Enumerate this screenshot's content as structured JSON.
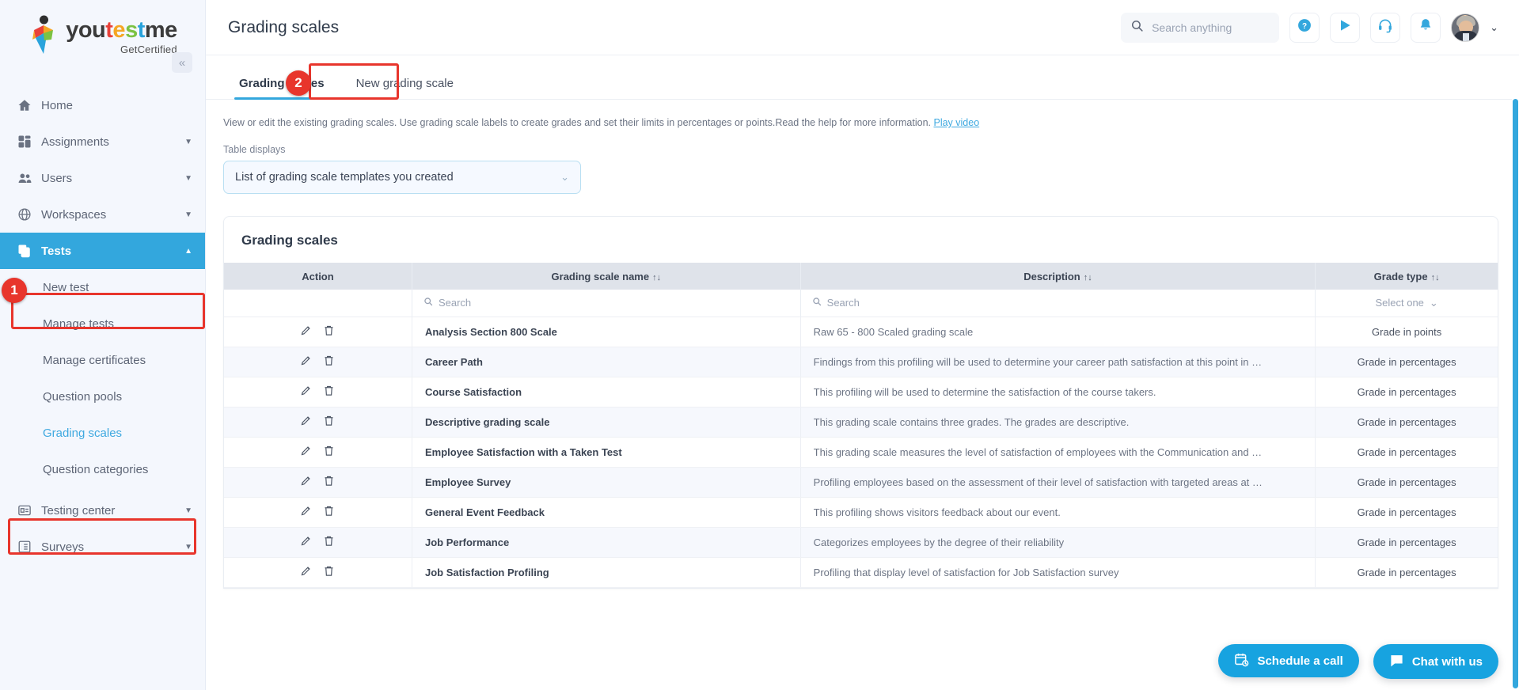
{
  "brand": {
    "name_parts": [
      "you",
      "t",
      "e",
      "s",
      "t",
      "me"
    ],
    "subtitle": "GetCertified",
    "accent": "#33a7dd"
  },
  "sidebar": {
    "collapse_icon": "double-chevron-left",
    "items": [
      {
        "label": "Home",
        "icon": "home-icon",
        "has_caret": false,
        "active": false
      },
      {
        "label": "Assignments",
        "icon": "assignments-icon",
        "has_caret": true,
        "active": false
      },
      {
        "label": "Users",
        "icon": "users-icon",
        "has_caret": true,
        "active": false
      },
      {
        "label": "Workspaces",
        "icon": "globe-icon",
        "has_caret": true,
        "active": false
      },
      {
        "label": "Tests",
        "icon": "tests-icon",
        "has_caret": true,
        "active": true
      }
    ],
    "sub_items": [
      {
        "label": "New test",
        "current": false
      },
      {
        "label": "Manage tests",
        "current": false
      },
      {
        "label": "Manage certificates",
        "current": false
      },
      {
        "label": "Question pools",
        "current": false
      },
      {
        "label": "Grading scales",
        "current": true
      },
      {
        "label": "Question categories",
        "current": false
      }
    ],
    "bottom_items": [
      {
        "label": "Testing center",
        "icon": "testing-center-icon",
        "has_caret": true
      },
      {
        "label": "Surveys",
        "icon": "surveys-icon",
        "has_caret": true
      }
    ]
  },
  "annotations": [
    {
      "number": "1",
      "target": "sidebar-tests-item"
    },
    {
      "number": "2",
      "target": "new-grading-scale-tab"
    }
  ],
  "header": {
    "title": "Grading scales",
    "search_placeholder": "Search anything",
    "search_value": "",
    "icons": [
      {
        "name": "help-icon",
        "glyph": "?"
      },
      {
        "name": "play-icon",
        "glyph": "▶"
      },
      {
        "name": "support-headset-icon",
        "glyph": "headset"
      },
      {
        "name": "notifications-bell-icon",
        "glyph": "bell"
      }
    ],
    "profile_caret": "chevron-down"
  },
  "tabs": [
    {
      "label": "Grading scales",
      "active": true
    },
    {
      "label": "New grading scale",
      "active": false
    }
  ],
  "hint": {
    "text": "View or edit the existing grading scales. Use grading scale labels to create grades and set their limits in percentages or points.Read the help for more information. ",
    "link_label": "Play video"
  },
  "table_displays": {
    "label": "Table displays",
    "value": "List of grading scale templates you created",
    "caret": "chevron-down"
  },
  "card": {
    "title": "Grading scales",
    "columns": [
      {
        "label": "Action",
        "sortable": false
      },
      {
        "label": "Grading scale name",
        "sortable": true,
        "sort_glyph": "↑↓"
      },
      {
        "label": "Description",
        "sortable": true,
        "sort_glyph": "↑↓"
      },
      {
        "label": "Grade type",
        "sortable": true,
        "sort_glyph": "↑↓"
      }
    ],
    "filters": {
      "name_search_placeholder": "Search",
      "description_search_placeholder": "Search",
      "grade_type_select": "Select one"
    },
    "rows": [
      {
        "name": "Analysis Section 800 Scale",
        "description": "Raw 65 - 800 Scaled grading scale",
        "grade_type": "Grade in points"
      },
      {
        "name": "Career Path",
        "description": "Findings from this profiling will be used to determine your career path satisfaction at this point in …",
        "grade_type": "Grade in percentages"
      },
      {
        "name": "Course Satisfaction",
        "description": "This profiling will be used to determine the satisfaction of the course takers.",
        "grade_type": "Grade in percentages"
      },
      {
        "name": "Descriptive grading scale",
        "description": "This grading scale contains three grades. The grades are descriptive.",
        "grade_type": "Grade in percentages"
      },
      {
        "name": "Employee Satisfaction with a Taken Test",
        "description": "This grading scale measures the level of satisfaction of employees with the Communication and …",
        "grade_type": "Grade in percentages"
      },
      {
        "name": "Employee Survey",
        "description": "Profiling employees based on the assessment of their level of satisfaction with targeted areas at …",
        "grade_type": "Grade in percentages"
      },
      {
        "name": "General Event Feedback",
        "description": "This profiling shows visitors feedback about our event.",
        "grade_type": "Grade in percentages"
      },
      {
        "name": "Job Performance",
        "description": "Categorizes employees by the degree of their reliability",
        "grade_type": "Grade in percentages"
      },
      {
        "name": "Job Satisfaction Profiling",
        "description": "Profiling that display level of satisfaction for Job Satisfaction survey",
        "grade_type": "Grade in percentages"
      }
    ],
    "row_actions": [
      {
        "name": "edit-icon",
        "title": "Edit"
      },
      {
        "name": "delete-icon",
        "title": "Delete"
      }
    ]
  },
  "floating": {
    "schedule_label": "Schedule a call",
    "chat_label": "Chat with us"
  }
}
